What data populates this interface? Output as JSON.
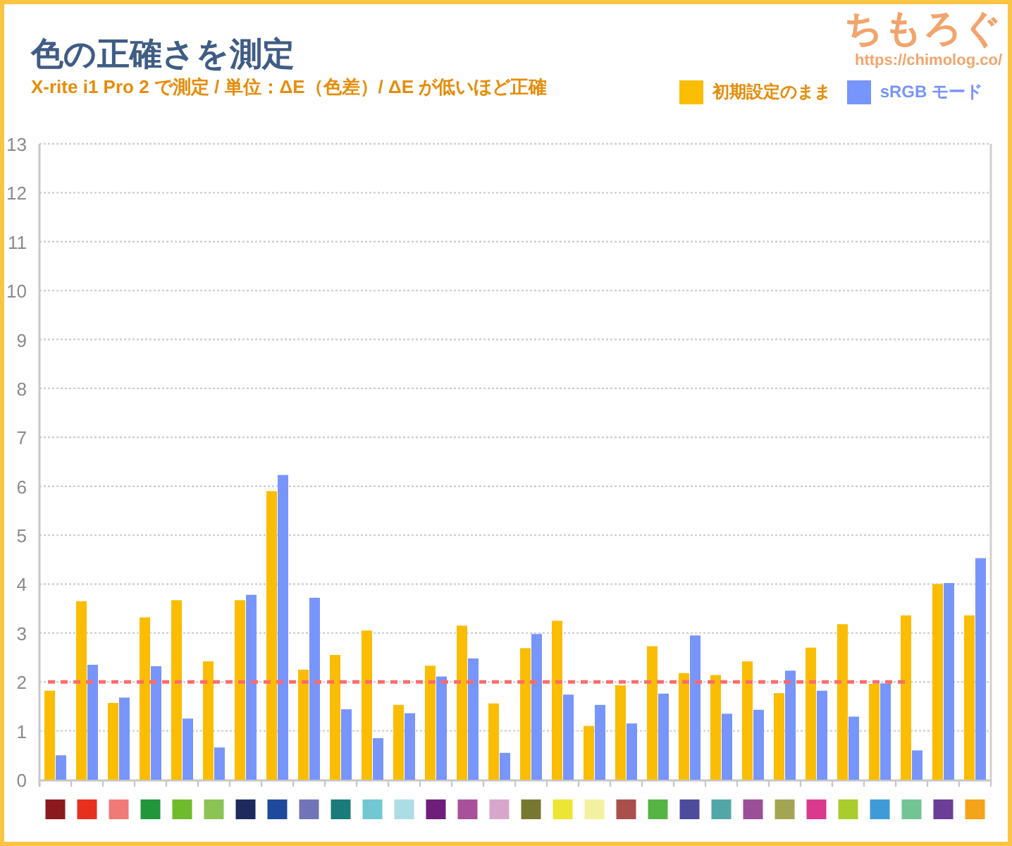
{
  "header": {
    "title": "色の正確さを測定",
    "subtitle": "X-rite i1 Pro 2 で測定 / 単位：ΔE（色差）/ ΔE が低いほど正確",
    "logo": "ちもろぐ",
    "url": "https://chimolog.co/"
  },
  "chart": {
    "chart_data": {
      "type": "bar",
      "ylim": [
        0,
        13
      ],
      "yticks": [
        0,
        1,
        2,
        3,
        4,
        5,
        6,
        7,
        8,
        9,
        10,
        11,
        12,
        13
      ],
      "series": [
        {
          "name": "初期設定のまま",
          "color": "#fbbc04",
          "values": [
            1.82,
            3.65,
            1.57,
            3.32,
            3.67,
            2.42,
            3.67,
            5.9,
            2.25,
            2.55,
            3.05,
            1.53,
            2.33,
            3.15,
            1.56,
            2.69,
            3.25,
            1.1,
            1.93,
            2.73,
            2.18,
            2.14,
            2.42,
            1.77,
            2.7,
            3.18,
            1.96,
            3.36,
            4.0,
            3.36
          ]
        },
        {
          "name": "sRGB モード",
          "color": "#7895fc",
          "values": [
            0.5,
            2.35,
            1.68,
            2.32,
            1.25,
            0.66,
            3.78,
            6.23,
            3.72,
            1.44,
            0.85,
            1.36,
            2.11,
            2.48,
            0.55,
            2.98,
            1.74,
            1.53,
            1.15,
            1.76,
            2.95,
            1.35,
            1.43,
            2.23,
            1.82,
            1.29,
            1.97,
            0.6,
            4.02,
            4.53
          ]
        }
      ],
      "grid": true,
      "ref_lines": [
        {
          "axis": "y",
          "value": 2,
          "color": "#ff6b6b"
        }
      ]
    },
    "swatches": [
      {
        "color": "#8b1a1f"
      },
      {
        "color": "#e8301e"
      },
      {
        "color": "#ef7a78"
      },
      {
        "color": "#21963a"
      },
      {
        "color": "#6fbb2c"
      },
      {
        "color": "#8cc355"
      },
      {
        "color": "#1f2a5c"
      },
      {
        "color": "#1f4a9c"
      },
      {
        "color": "#7175b8"
      },
      {
        "color": "#1b7b78"
      },
      {
        "color": "#72c7d3"
      },
      {
        "color": "#acdde4"
      },
      {
        "color": "#6f1f7a"
      },
      {
        "color": "#a8519a"
      },
      {
        "color": "#d9a6cb"
      },
      {
        "color": "#77782f"
      },
      {
        "color": "#ede533"
      },
      {
        "color": "#f3f1a1"
      },
      {
        "color": "#a9504d"
      },
      {
        "color": "#56b444"
      },
      {
        "color": "#4f4b9c"
      },
      {
        "color": "#52a6a6"
      },
      {
        "color": "#9b4f98"
      },
      {
        "color": "#a4a552"
      },
      {
        "color": "#d93a8e"
      },
      {
        "color": "#aacc2c"
      },
      {
        "color": "#3f9bd8"
      },
      {
        "color": "#72c494"
      },
      {
        "color": "#6b3f96"
      },
      {
        "color": "#f5a31a"
      }
    ]
  }
}
